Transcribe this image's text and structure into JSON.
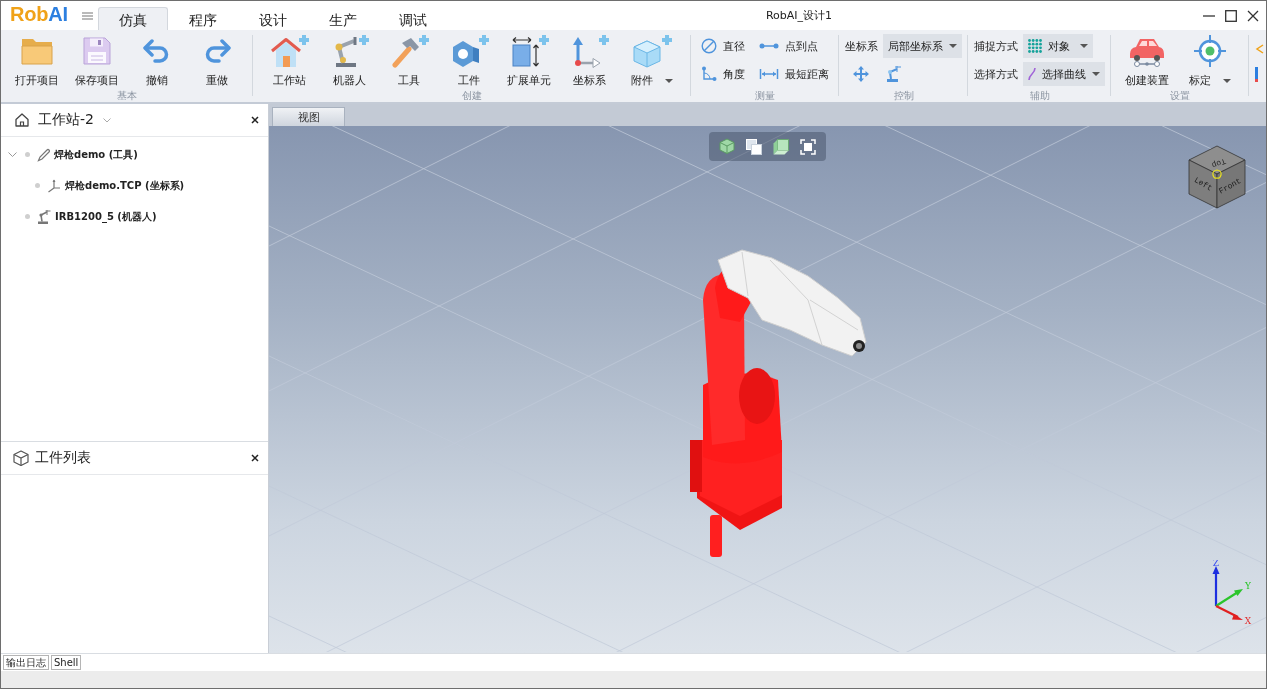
{
  "window": {
    "logo": [
      "Rob",
      "AI"
    ],
    "title": "RobAI_设计1"
  },
  "menu_tabs": [
    {
      "label": "仿真",
      "selected": true
    },
    {
      "label": "程序",
      "selected": false
    },
    {
      "label": "设计",
      "selected": false
    },
    {
      "label": "生产",
      "selected": false
    },
    {
      "label": "调试",
      "selected": false
    }
  ],
  "ribbon": {
    "groups": [
      {
        "label": "基本",
        "items": [
          {
            "kind": "large",
            "label": "打开项目",
            "dropdown": false
          },
          {
            "kind": "large",
            "label": "保存项目",
            "dropdown": false
          },
          {
            "kind": "large",
            "label": "撤销",
            "dropdown": false
          },
          {
            "kind": "large",
            "label": "重做",
            "dropdown": false
          }
        ]
      },
      {
        "label": "创建",
        "items": [
          {
            "kind": "large",
            "label": "工作站",
            "dropdown": false
          },
          {
            "kind": "large",
            "label": "机器人",
            "dropdown": false
          },
          {
            "kind": "large",
            "label": "工具",
            "dropdown": false
          },
          {
            "kind": "large",
            "label": "工件",
            "dropdown": false
          },
          {
            "kind": "large",
            "label": "扩展单元",
            "dropdown": false
          },
          {
            "kind": "large",
            "label": "坐标系",
            "dropdown": false
          },
          {
            "kind": "large",
            "label": "附件",
            "dropdown": true
          }
        ]
      },
      {
        "label": "测量",
        "items": [
          {
            "kind": "small",
            "label": "直径"
          },
          {
            "kind": "small",
            "label": "点到点"
          },
          {
            "kind": "small",
            "label": "角度"
          },
          {
            "kind": "small",
            "label": "最短距离"
          }
        ]
      },
      {
        "label": "控制",
        "items": [
          {
            "kind": "combo",
            "label": "坐标系",
            "value": "局部坐标系"
          },
          {
            "kind": "icon"
          },
          {
            "kind": "icon"
          }
        ]
      },
      {
        "label": "辅助",
        "items": [
          {
            "kind": "combo",
            "label": "捕捉方式",
            "value": "对象"
          },
          {
            "kind": "combo",
            "label": "选择方式",
            "value": "选择曲线"
          }
        ]
      },
      {
        "label": "设置",
        "items": [
          {
            "kind": "large",
            "label": "创建装置",
            "dropdown": false
          },
          {
            "kind": "large",
            "label": "标定",
            "dropdown": true
          }
        ]
      }
    ]
  },
  "workstation_panel": {
    "title": "工作站-2",
    "tree": [
      {
        "label": "焊枪demo (工具)",
        "kind": "tool",
        "expanded": true,
        "children": [
          {
            "label": "焊枪demo.TCP (坐标系)",
            "kind": "frame"
          }
        ]
      },
      {
        "label": "IRB1200_5 (机器人)",
        "kind": "robot"
      }
    ]
  },
  "parts_panel": {
    "title": "工件列表"
  },
  "viewport": {
    "tab": "视图",
    "view_cube": {
      "faces": [
        "Top",
        "Left",
        "Front"
      ]
    },
    "axis_triad": {
      "labels": [
        "Z",
        "Y",
        "X"
      ]
    }
  },
  "bottom_tabs": [
    "输出日志",
    "Shell"
  ]
}
